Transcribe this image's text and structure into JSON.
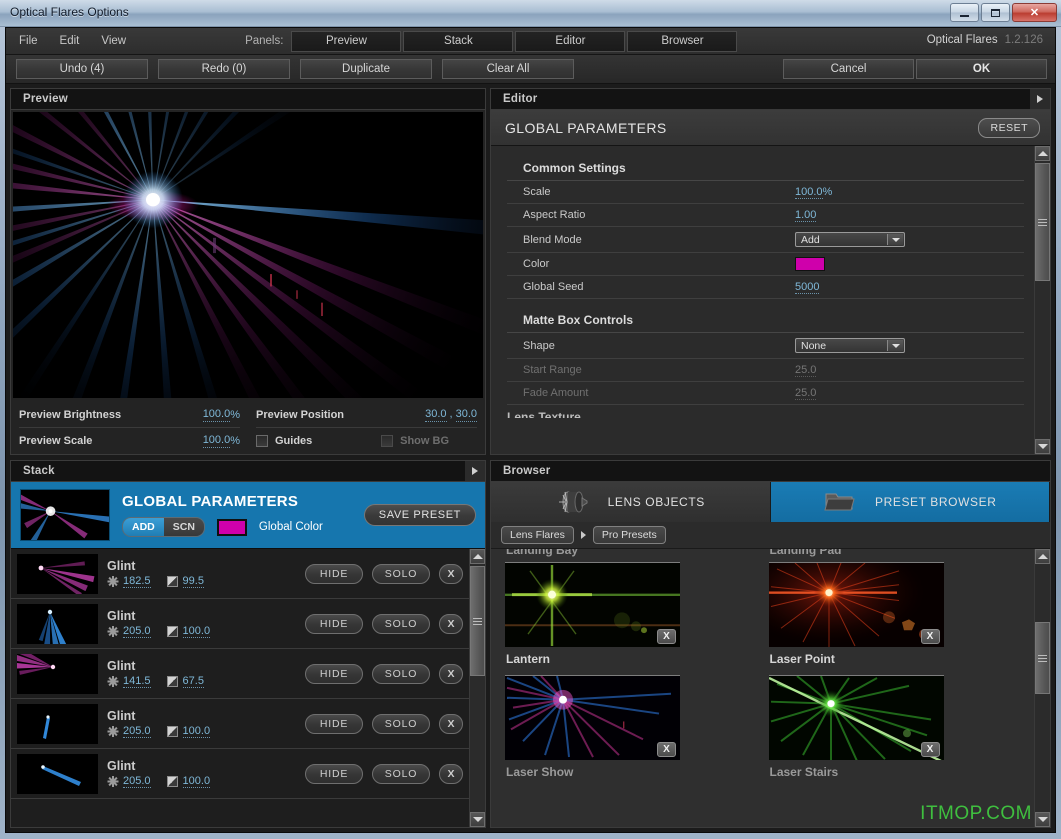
{
  "window": {
    "title": "Optical Flares Options",
    "minimize_label": "minimize",
    "maximize_label": "maximize",
    "close_label": "✕"
  },
  "menubar": {
    "items": [
      "File",
      "Edit",
      "View"
    ],
    "panels_label": "Panels:",
    "panel_tabs": [
      "Preview",
      "Stack",
      "Editor",
      "Browser"
    ],
    "brand": "Optical Flares",
    "version": "1.2.126"
  },
  "toolbar": {
    "undo": "Undo (4)",
    "redo": "Redo (0)",
    "duplicate": "Duplicate",
    "clear_all": "Clear All",
    "cancel": "Cancel",
    "ok": "OK"
  },
  "preview": {
    "panel_title": "Preview",
    "fields": {
      "brightness_label": "Preview Brightness",
      "brightness_value": "100.0",
      "brightness_unit": "%",
      "scale_label": "Preview Scale",
      "scale_value": "100.0",
      "scale_unit": "%",
      "position_label": "Preview Position",
      "position_x": "30.0",
      "position_sep": ",",
      "position_y": "30.0",
      "guides_label": "Guides",
      "show_bg_label": "Show BG"
    }
  },
  "stack": {
    "panel_title": "Stack",
    "global": {
      "title": "GLOBAL PARAMETERS",
      "blend_add": "ADD",
      "blend_scn": "SCN",
      "color_label": "Global Color",
      "color_hex": "#cf00ab",
      "save_preset": "SAVE PRESET"
    },
    "rows": [
      {
        "name": "Glint",
        "brightness": "182.5",
        "opacity": "99.5",
        "hide": "HIDE",
        "solo": "SOLO",
        "remove": "X"
      },
      {
        "name": "Glint",
        "brightness": "205.0",
        "opacity": "100.0",
        "hide": "HIDE",
        "solo": "SOLO",
        "remove": "X"
      },
      {
        "name": "Glint",
        "brightness": "141.5",
        "opacity": "67.5",
        "hide": "HIDE",
        "solo": "SOLO",
        "remove": "X"
      },
      {
        "name": "Glint",
        "brightness": "205.0",
        "opacity": "100.0",
        "hide": "HIDE",
        "solo": "SOLO",
        "remove": "X"
      },
      {
        "name": "Glint",
        "brightness": "205.0",
        "opacity": "100.0",
        "hide": "HIDE",
        "solo": "SOLO",
        "remove": "X"
      }
    ]
  },
  "editor": {
    "panel_title": "Editor",
    "header_title": "GLOBAL PARAMETERS",
    "reset_label": "RESET",
    "sections": [
      {
        "title": "Common Settings",
        "rows": [
          {
            "label": "Scale",
            "type": "number",
            "value": "100.0",
            "unit": "%",
            "disabled": false
          },
          {
            "label": "Aspect Ratio",
            "type": "number",
            "value": "1.00",
            "unit": "",
            "disabled": false
          },
          {
            "label": "Blend Mode",
            "type": "select",
            "value": "Add",
            "unit": "",
            "disabled": false
          },
          {
            "label": "Color",
            "type": "color",
            "value": "#cf00ab",
            "unit": "",
            "disabled": false
          },
          {
            "label": "Global Seed",
            "type": "number",
            "value": "5000",
            "unit": "",
            "disabled": false
          }
        ]
      },
      {
        "title": "Matte Box Controls",
        "rows": [
          {
            "label": "Shape",
            "type": "select",
            "value": "None",
            "unit": "",
            "disabled": false
          },
          {
            "label": "Start Range",
            "type": "number",
            "value": "25.0",
            "unit": "",
            "disabled": true
          },
          {
            "label": "Fade Amount",
            "type": "number",
            "value": "25.0",
            "unit": "",
            "disabled": true
          }
        ]
      }
    ],
    "next_section_clipped": "Lens Texture"
  },
  "browser": {
    "panel_title": "Browser",
    "tabs": [
      {
        "label": "LENS OBJECTS",
        "icon": "lens-icon",
        "active": false
      },
      {
        "label": "PRESET BROWSER",
        "icon": "folder-icon",
        "active": true
      }
    ],
    "breadcrumbs": [
      "Lens Flares",
      "Pro Presets"
    ],
    "clipped_top_row": [
      "Landing Bay",
      "Landing Pad"
    ],
    "presets": [
      {
        "name": "Lantern",
        "remove": "X",
        "theme": "green-yellow"
      },
      {
        "name": "Laser Point",
        "remove": "X",
        "theme": "red"
      },
      {
        "name": "Laser Show",
        "remove": "X",
        "theme": "blue-magenta"
      },
      {
        "name": "Laser Stairs",
        "remove": "X",
        "theme": "green"
      }
    ],
    "watermark": "ITMOP.COM"
  }
}
